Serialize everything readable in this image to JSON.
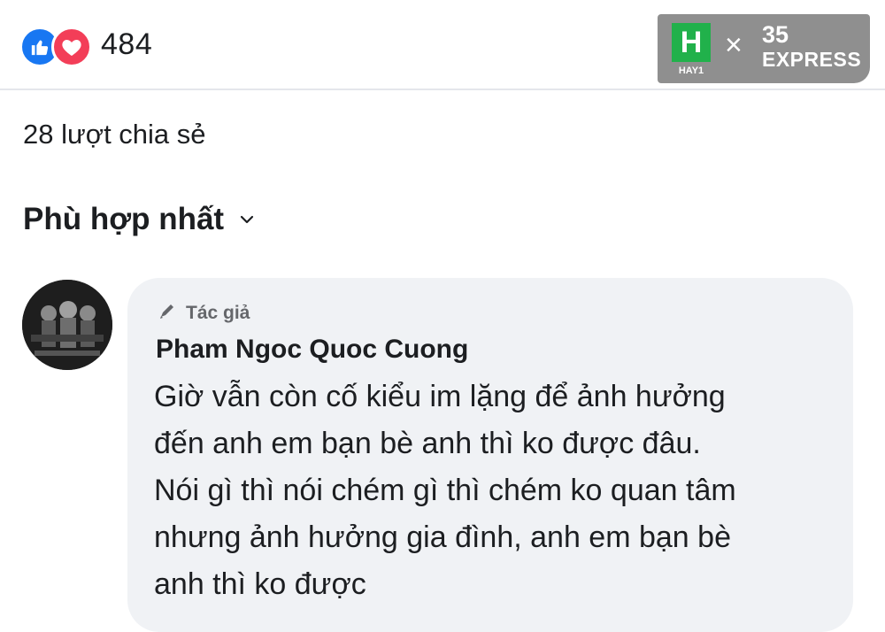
{
  "reactions": {
    "count": "484",
    "icons": [
      "like-icon",
      "love-icon"
    ],
    "like_color": "#1877f2",
    "love_color": "#f33e58"
  },
  "shares": {
    "label": "28 lượt chia sẻ"
  },
  "sort": {
    "label": "Phù hợp nhất",
    "icon": "chevron-down-icon"
  },
  "comment": {
    "badge_icon": "pen-icon",
    "badge_label": "Tác giả",
    "author": "Pham Ngoc Quoc Cuong",
    "lines": [
      "Giờ vẫn còn cố kiểu im lặng để ảnh hưởng",
      "đến anh em bạn bè anh thì ko được đâu.",
      "Nói gì thì nói chém gì thì chém ko quan tâm",
      "nhưng ảnh hưởng gia đình, anh em bạn bè",
      "anh thì ko được"
    ],
    "bubble_color": "#f0f2f5"
  },
  "watermark": {
    "logo_letter": "H",
    "logo_caption": "HAY1",
    "separator": "×",
    "partner_number": "35",
    "partner_name": "EXPRESS",
    "logo_color": "#21b14b"
  }
}
